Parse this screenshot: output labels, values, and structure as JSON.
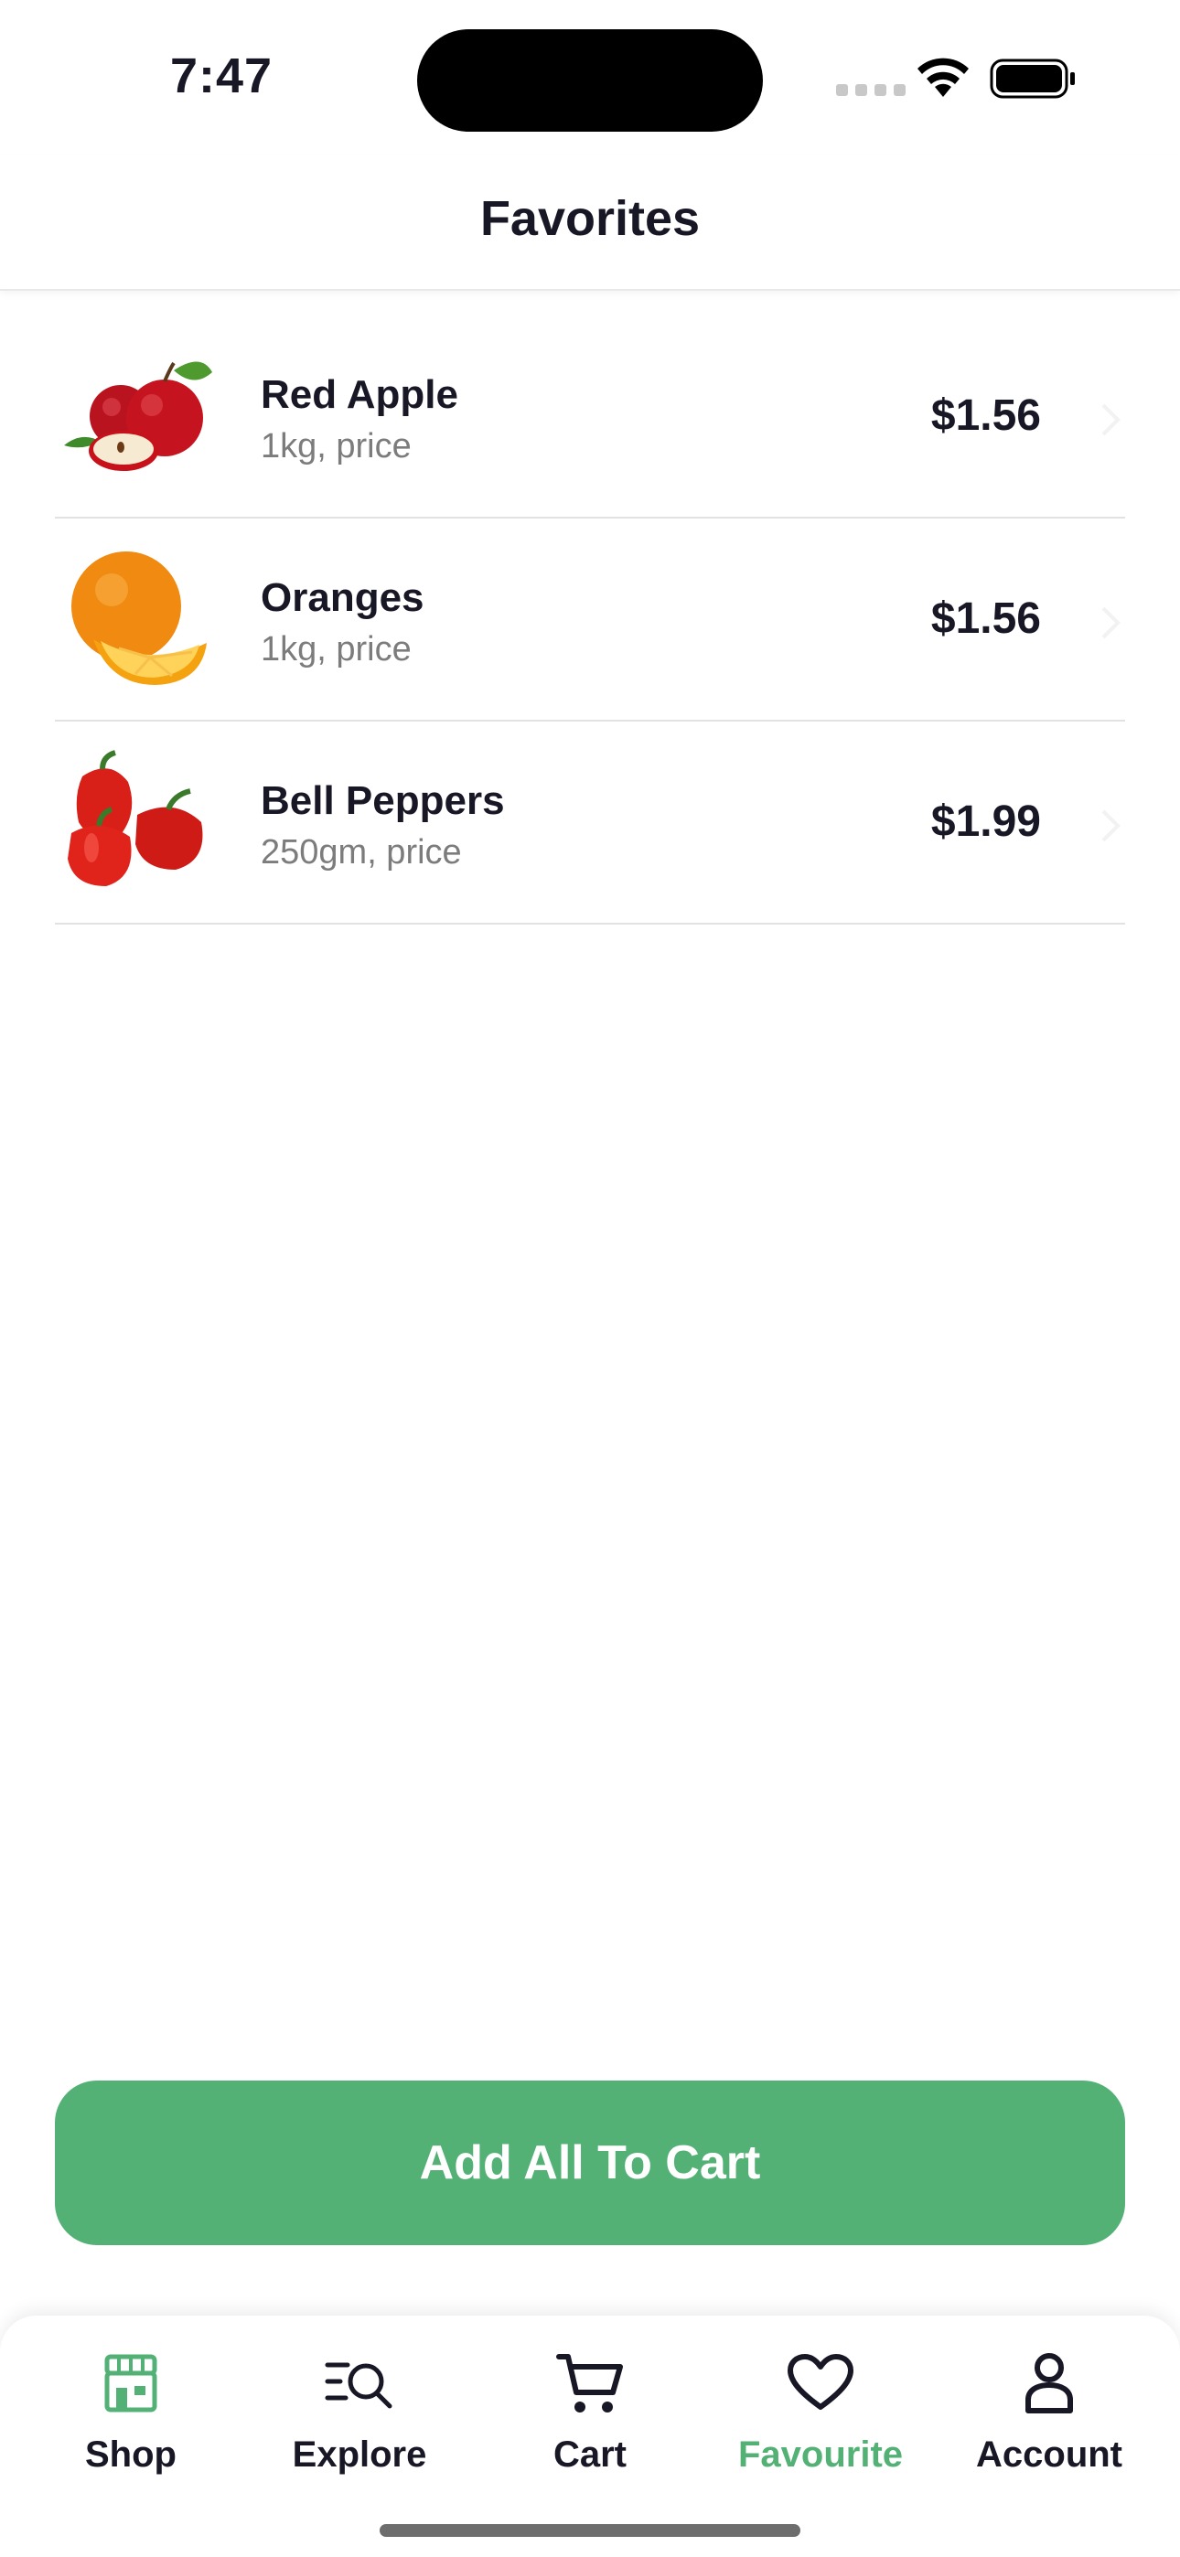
{
  "status": {
    "time": "7:47"
  },
  "header": {
    "title": "Favorites"
  },
  "favorites": [
    {
      "name": "Red Apple",
      "unit": "1kg, price",
      "price": "$1.56",
      "image": "red-apple"
    },
    {
      "name": "Oranges",
      "unit": "1kg, price",
      "price": "$1.56",
      "image": "oranges"
    },
    {
      "name": "Bell Peppers",
      "unit": "250gm, price",
      "price": "$1.99",
      "image": "bell-peppers"
    }
  ],
  "actions": {
    "add_all": "Add All To Cart"
  },
  "tabs": [
    {
      "label": "Shop",
      "icon": "store-icon"
    },
    {
      "label": "Explore",
      "icon": "explore-icon"
    },
    {
      "label": "Cart",
      "icon": "cart-icon"
    },
    {
      "label": "Favourite",
      "icon": "heart-icon",
      "active": true
    },
    {
      "label": "Account",
      "icon": "user-icon"
    }
  ],
  "colors": {
    "accent": "#53b175",
    "text": "#181725",
    "muted": "#7c7c7c"
  }
}
